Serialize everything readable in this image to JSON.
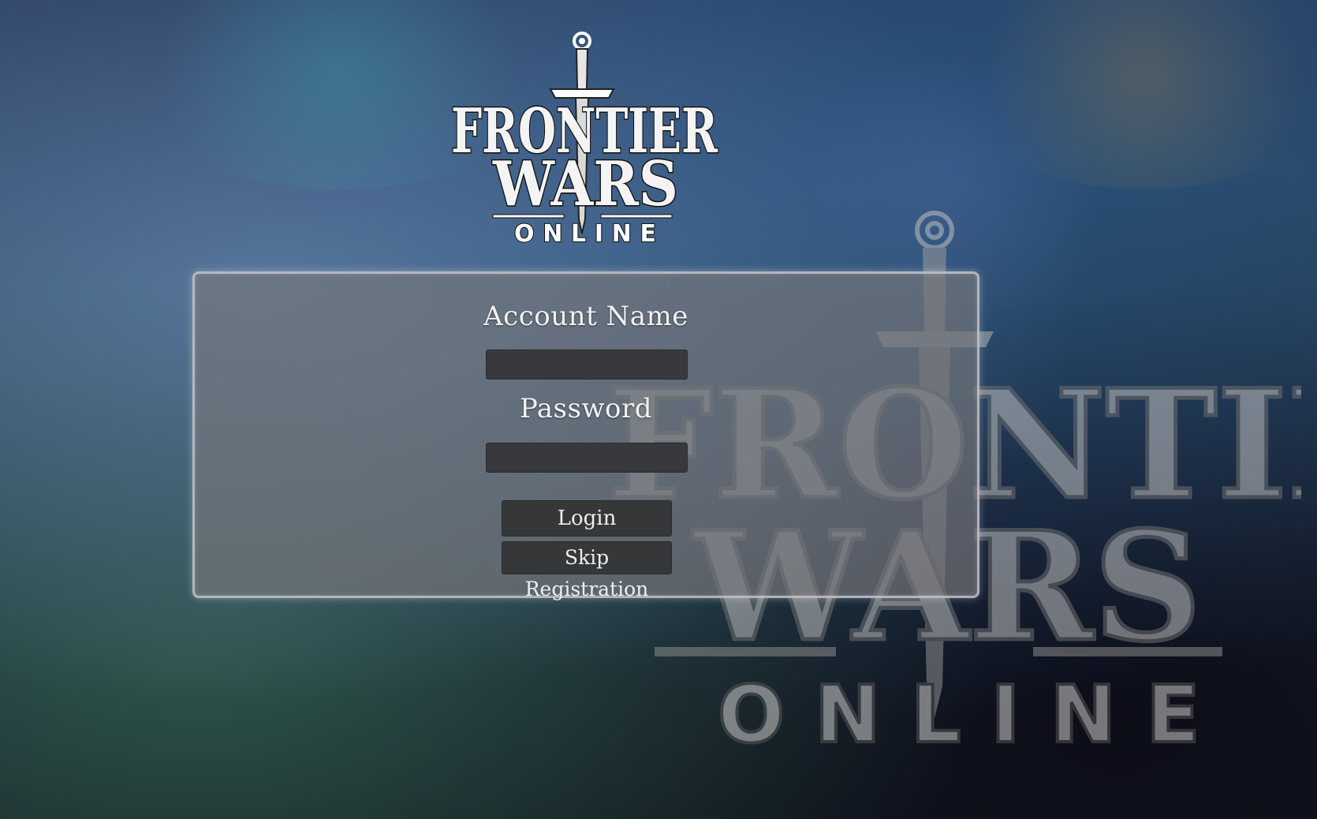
{
  "app": {
    "title": "Frontier Wars Online",
    "logo_text": {
      "line1": "FRONTIER",
      "line2": "WARS",
      "line3": "ONLINE"
    }
  },
  "login_form": {
    "account_label": "Account Name",
    "account_value": "",
    "password_label": "Password",
    "password_value": "",
    "login_button": "Login",
    "skip_button": "Skip Registration"
  },
  "colors": {
    "panel_bg": "#76767a",
    "input_bg": "#37393c",
    "button_bg": "#363739",
    "text": "#f2f2f2"
  }
}
